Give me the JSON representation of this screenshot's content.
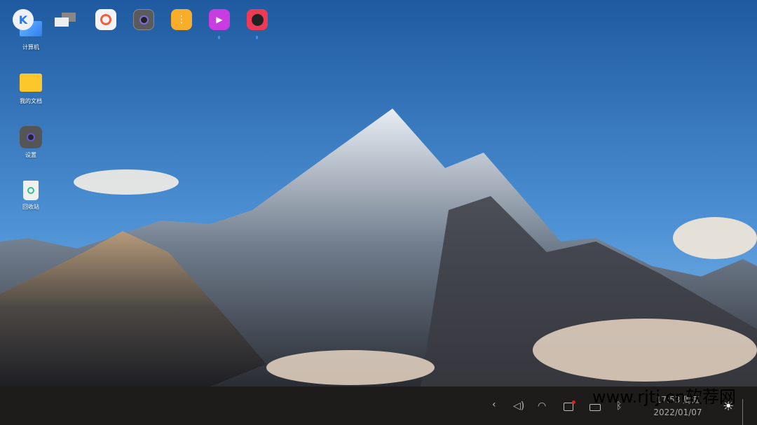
{
  "desktop": {
    "icons": [
      {
        "label": "计算机",
        "icon": "computer-icon"
      },
      {
        "label": "我的文档",
        "icon": "folder-icon"
      },
      {
        "label": "设置",
        "icon": "settings-icon"
      },
      {
        "label": "回收站",
        "icon": "trash-icon"
      }
    ]
  },
  "taskbar": {
    "apps": [
      {
        "name": "start-menu",
        "icon": "kylin-logo-icon"
      },
      {
        "name": "multitask-view",
        "icon": "windows-icon"
      },
      {
        "name": "search",
        "icon": "search-app-icon"
      },
      {
        "name": "settings",
        "icon": "settings-icon"
      },
      {
        "name": "file-transfer",
        "icon": "transfer-icon"
      },
      {
        "name": "video-player",
        "icon": "video-icon",
        "running": true
      },
      {
        "name": "music-player",
        "icon": "music-icon",
        "running": true
      }
    ],
    "tray": {
      "expand": "‹",
      "volume": "🔈",
      "wifi": "wifi-icon",
      "notifications": "notification-icon",
      "battery": "battery-icon",
      "bluetooth": "bluetooth-icon"
    },
    "clock": {
      "time": "17:53 周五",
      "date": "2022/01/07"
    },
    "night_mode": "night-mode-icon"
  },
  "watermark": "www.rjtj.cn软荐网",
  "colors": {
    "taskbar": "#1d1c1b",
    "accent": "#3b8ff0",
    "notify": "#e02020"
  }
}
